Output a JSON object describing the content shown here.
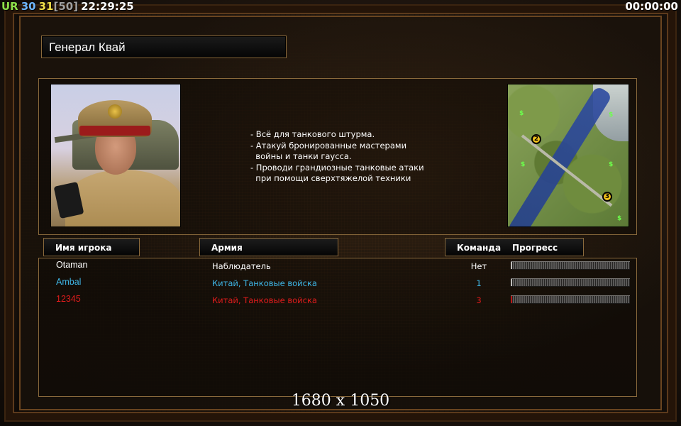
{
  "hud": {
    "tag": "UR",
    "value_a": "30",
    "value_b": "31",
    "bracket": "[50]",
    "clock": "22:29:25",
    "timer": "00:00:00"
  },
  "general": {
    "title": "Генерал Квай",
    "description": [
      "- Всё для танкового штурма.",
      "- Атакуй бронированные мастерами",
      "  войны и танки гаусса.",
      "- Проводи грандиозные танковые атаки",
      "  при помощи сверхтяжелой техники"
    ]
  },
  "minimap": {
    "markers": [
      "2",
      "3"
    ],
    "cash_symbol": "$"
  },
  "columns": {
    "player_name": "Имя игрока",
    "army": "Армия",
    "team": "Команда",
    "progress": "Прогресс"
  },
  "players": [
    {
      "name": "Otaman",
      "army": "Наблюдатель",
      "team": "Нет",
      "color": "#ffffff",
      "progress": 0.0
    },
    {
      "name": "Ambal",
      "army": "Китай, Танковые войска",
      "team": "1",
      "color": "#3fb6e6",
      "progress": 0.0
    },
    {
      "name": "12345",
      "army": "Китай, Танковые войска",
      "team": "3",
      "color": "#e01c1c",
      "progress": 0.01
    }
  ],
  "overlay": {
    "resolution": "1680 x 1050"
  },
  "colors": {
    "border": "#8a6a3c",
    "hud_green": "#8ee04a",
    "hud_blue": "#6fb7ff",
    "hud_yellow": "#f2e04a"
  }
}
